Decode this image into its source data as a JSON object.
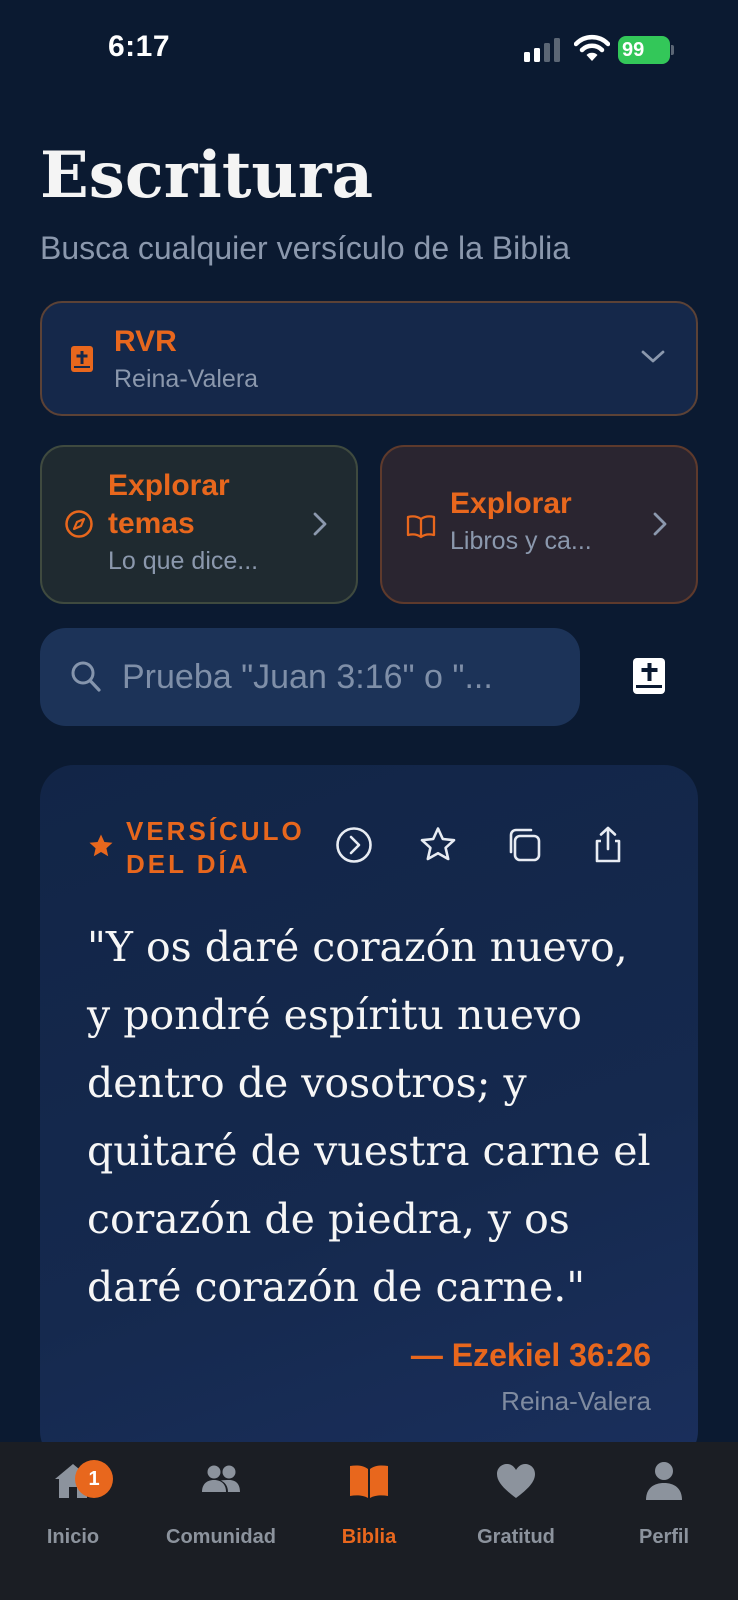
{
  "status_bar": {
    "time": "6:17",
    "battery": "99"
  },
  "header": {
    "title": "Escritura",
    "subtitle": "Busca cualquier versículo de la Biblia"
  },
  "version_selector": {
    "code": "RVR",
    "name": "Reina-Valera",
    "icon": "bible-icon"
  },
  "explore": {
    "topics": {
      "title": "Explorar temas",
      "subtitle": "Lo que dice...",
      "icon": "compass-icon"
    },
    "books": {
      "title": "Explorar",
      "subtitle": "Libros y ca...",
      "icon": "open-book-icon"
    }
  },
  "search": {
    "placeholder": "Prueba \"Juan 3:16\" o \"..."
  },
  "verse_of_day": {
    "label": "VERSÍCULO DEL DÍA",
    "text": "\"Y os daré corazón nuevo, y pondré espíritu nuevo dentro de vosotros; y quitaré de vuestra carne el corazón de piedra, y os daré corazón de carne.\"",
    "reference": "— Ezekiel 36:26",
    "version": "Reina-Valera",
    "actions": [
      "next-icon",
      "star-icon",
      "copy-icon",
      "share-icon"
    ]
  },
  "tab_bar": {
    "tabs": [
      {
        "label": "Inicio",
        "icon": "home-icon",
        "badge": "1",
        "active": false
      },
      {
        "label": "Comunidad",
        "icon": "people-icon",
        "active": false
      },
      {
        "label": "Biblia",
        "icon": "book-icon",
        "active": true
      },
      {
        "label": "Gratitud",
        "icon": "heart-icon",
        "active": false
      },
      {
        "label": "Perfil",
        "icon": "person-icon",
        "active": false
      }
    ]
  },
  "colors": {
    "background": "#0b1a31",
    "accent": "#e8671d",
    "muted_text": "#8b98ad",
    "battery": "#33c759"
  }
}
